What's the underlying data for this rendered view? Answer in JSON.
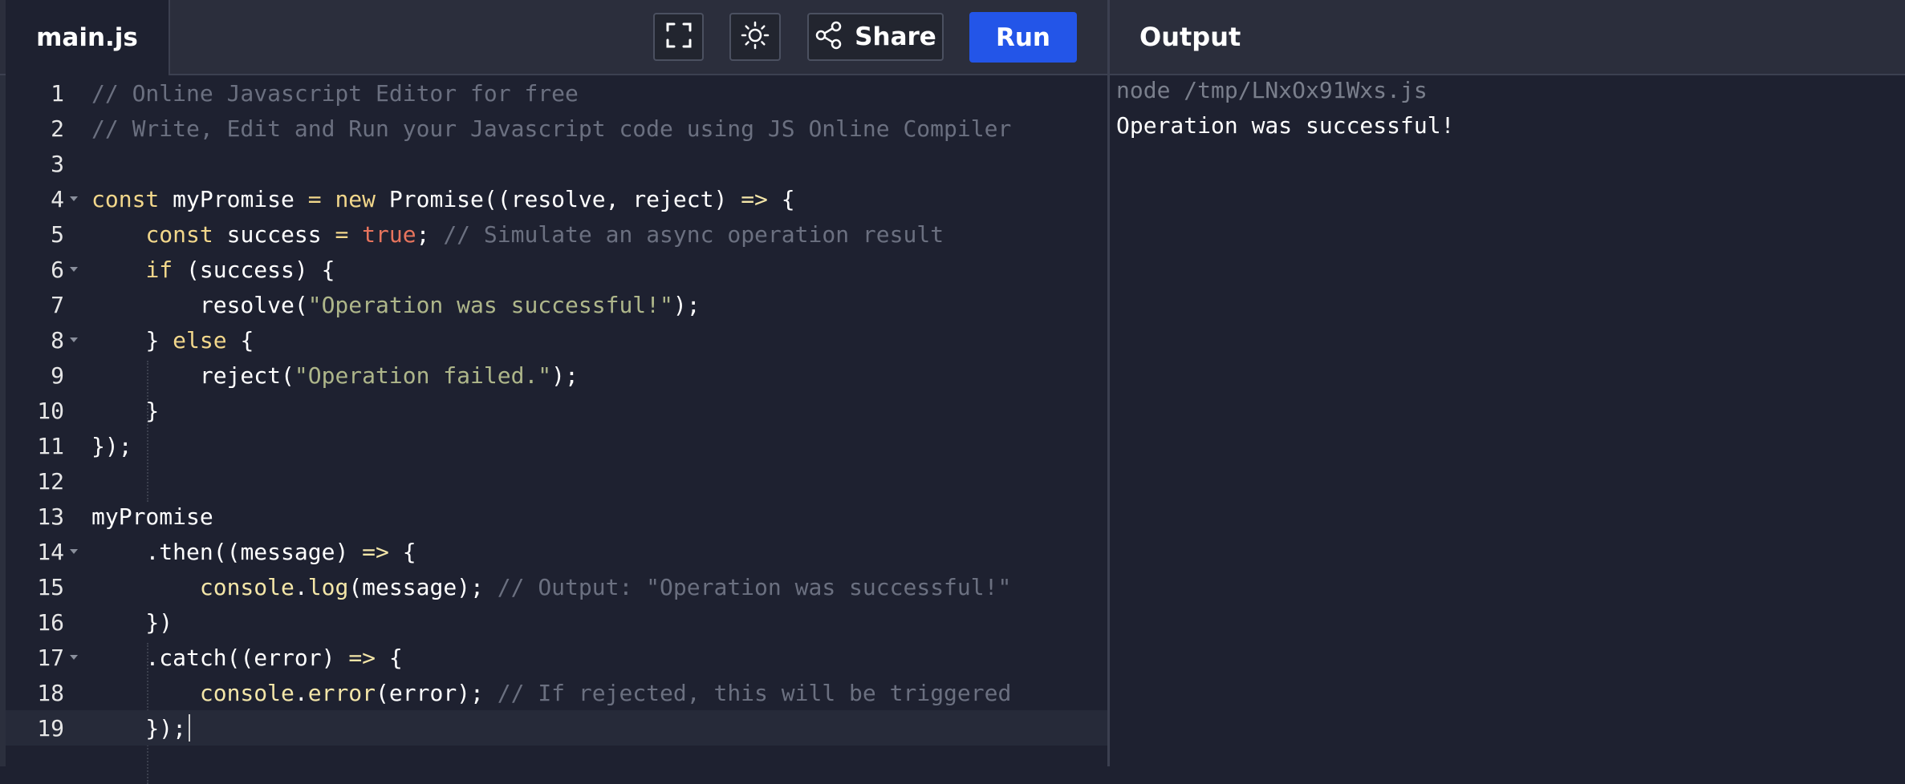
{
  "editor_tab": {
    "filename": "main.js"
  },
  "toolbar": {
    "fullscreen_icon": "fullscreen-icon",
    "theme_icon": "sun-icon",
    "share_icon": "share-icon",
    "share_label": "Share",
    "run_label": "Run"
  },
  "output_panel": {
    "title": "Output",
    "command": "node /tmp/LNxOx91Wxs.js",
    "result": "Operation was successful!"
  },
  "code": {
    "line_numbers": [
      "1",
      "2",
      "3",
      "4",
      "5",
      "6",
      "7",
      "8",
      "9",
      "10",
      "11",
      "12",
      "13",
      "14",
      "15",
      "16",
      "17",
      "18",
      "19"
    ],
    "l1": "// Online Javascript Editor for free",
    "l2": "// Write, Edit and Run your Javascript code using JS Online Compiler",
    "l4": {
      "kw_const": "const",
      "name": " myPromise ",
      "op": "=",
      "sp": " ",
      "kw_new": "new",
      "rest": " Promise((resolve, reject) ",
      "arrow": "=>",
      "tail": " {"
    },
    "l5": {
      "indent": "    ",
      "kw_const": "const",
      "name": " success ",
      "op": "=",
      "sp": " ",
      "val": "true",
      "semi": "; ",
      "comment": "// Simulate an async operation result"
    },
    "l6": {
      "indent": "    ",
      "kw_if": "if",
      "rest": " (success) {"
    },
    "l7": {
      "indent": "        ",
      "pre": "resolve(",
      "str": "\"Operation was successful!\"",
      "post": ");"
    },
    "l8": {
      "indent": "    ",
      "pre": "} ",
      "kw_else": "else",
      "post": " {"
    },
    "l9": {
      "indent": "        ",
      "pre": "reject(",
      "str": "\"Operation failed.\"",
      "post": ");"
    },
    "l10": "    }",
    "l11": "});",
    "l13": "myPromise",
    "l14": {
      "indent": "    ",
      "pre": ".then((message) ",
      "arrow": "=>",
      "post": " {"
    },
    "l15": {
      "indent": "        ",
      "obj": "console",
      "dot": ".",
      "fn": "log",
      "args": "(message); ",
      "comment": "// Output: \"Operation was successful!\""
    },
    "l16": "    })",
    "l17": {
      "indent": "    ",
      "pre": ".catch((error) ",
      "arrow": "=>",
      "post": " {"
    },
    "l18": {
      "indent": "        ",
      "obj": "console",
      "dot": ".",
      "fn": "error",
      "args": "(error); ",
      "comment": "// If rejected, this will be triggered"
    },
    "l19": "    });"
  },
  "colors": {
    "background": "#1e2130",
    "header": "#2b2e3c",
    "run_button": "#2355e8",
    "comment": "#6b7080",
    "keyword": "#f2d78b",
    "boolean": "#e7745d",
    "string": "#aeb68a"
  }
}
